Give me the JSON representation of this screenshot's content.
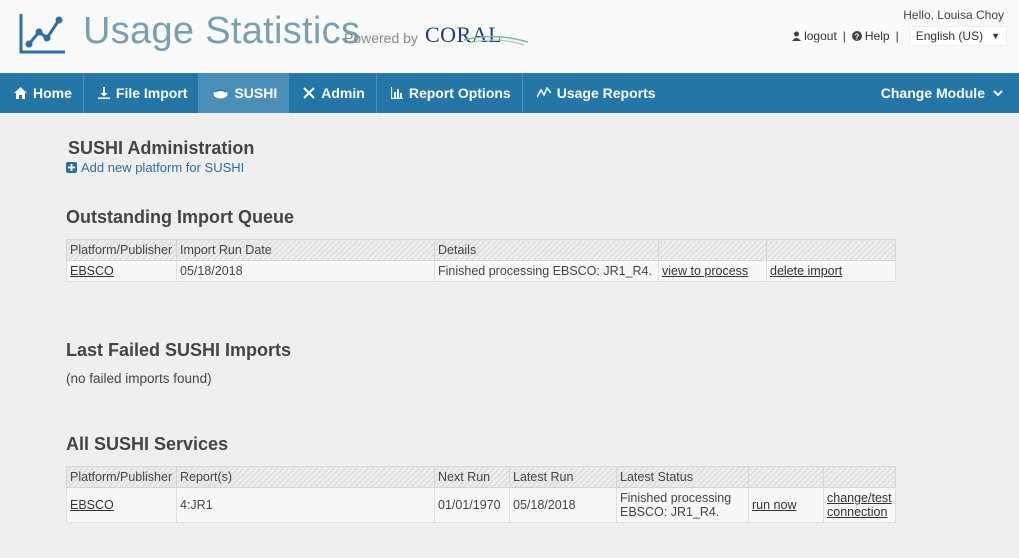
{
  "header": {
    "app_title": "Usage Statistics",
    "powered_by": "Powered by",
    "coral_logo_text": "CORAL",
    "greeting": "Hello, Louisa Choy",
    "logout": "logout",
    "help": "Help",
    "separator": "|",
    "language": "English (US)"
  },
  "nav": {
    "items": [
      {
        "label": "Home",
        "icon": "home-icon"
      },
      {
        "label": "File Import",
        "icon": "download-icon"
      },
      {
        "label": "SUSHI",
        "icon": "sushi-icon",
        "active": true
      },
      {
        "label": "Admin",
        "icon": "tools-icon"
      },
      {
        "label": "Report Options",
        "icon": "bar-chart-icon"
      },
      {
        "label": "Usage Reports",
        "icon": "line-chart-icon"
      }
    ],
    "change_module": "Change Module"
  },
  "sushi_admin": {
    "title": "SUSHI Administration",
    "add_link": "Add new platform for SUSHI"
  },
  "import_queue": {
    "title": "Outstanding Import Queue",
    "headers": [
      "Platform/Publisher",
      "Import Run Date",
      "Details",
      "",
      ""
    ],
    "rows": [
      {
        "platform": "EBSCO",
        "date": "05/18/2018",
        "details": "Finished processing EBSCO: JR1_R4.",
        "action1": "view to process",
        "action2": "delete import"
      }
    ]
  },
  "failed_imports": {
    "title": "Last Failed SUSHI Imports",
    "note": "(no failed imports found)"
  },
  "services": {
    "title": "All SUSHI Services",
    "headers": [
      "Platform/Publisher",
      "Report(s)",
      "Next Run",
      "Latest Run",
      "Latest Status",
      "",
      ""
    ],
    "rows": [
      {
        "platform": "EBSCO",
        "reports": "4:JR1",
        "next_run": "01/01/1970",
        "latest_run": "05/18/2018",
        "status_line1": "Finished processing",
        "status_line2": "EBSCO: JR1_R4.",
        "run_now": "run now",
        "change_line1": "change/test",
        "change_line2": "connection"
      }
    ]
  },
  "colors": {
    "nav_bg": "#2576a8",
    "nav_active": "#4b8fb9",
    "link": "#2d6e9e",
    "title": "#7a9fb0"
  }
}
